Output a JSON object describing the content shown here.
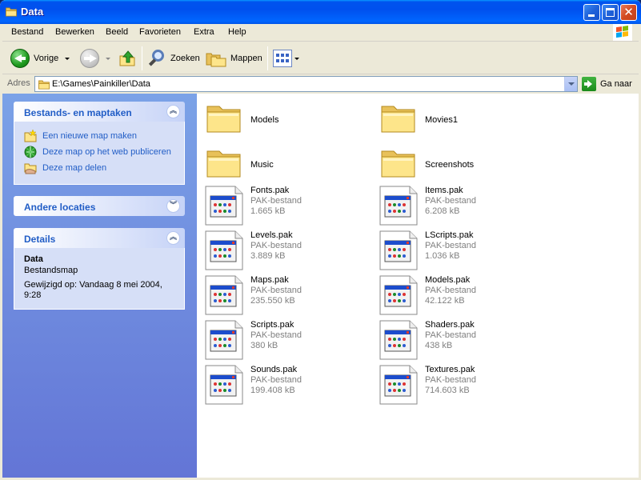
{
  "window": {
    "title": "Data"
  },
  "menu": [
    "Bestand",
    "Bewerken",
    "Beeld",
    "Favorieten",
    "Extra",
    "Help"
  ],
  "toolbar": {
    "back": "Vorige",
    "search": "Zoeken",
    "folders": "Mappen"
  },
  "address": {
    "label": "Adres",
    "value": "E:\\Games\\Painkiller\\Data",
    "go": "Ga naar"
  },
  "taskpane": {
    "tasks": {
      "title": "Bestands- en maptaken",
      "items": [
        "Een nieuwe map maken",
        "Deze map op het web publiceren",
        "Deze map delen"
      ]
    },
    "other": {
      "title": "Andere locaties"
    },
    "details": {
      "title": "Details",
      "name": "Data",
      "type": "Bestandsmap",
      "modified": "Gewijzigd op: Vandaag 8 mei 2004, 9:28"
    }
  },
  "folders": [
    "Models",
    "Movies1",
    "Music",
    "Screenshots"
  ],
  "files": [
    {
      "name": "Fonts.pak",
      "type": "PAK-bestand",
      "size": "1.665 kB"
    },
    {
      "name": "Items.pak",
      "type": "PAK-bestand",
      "size": "6.208 kB"
    },
    {
      "name": "Levels.pak",
      "type": "PAK-bestand",
      "size": "3.889 kB"
    },
    {
      "name": "LScripts.pak",
      "type": "PAK-bestand",
      "size": "1.036 kB"
    },
    {
      "name": "Maps.pak",
      "type": "PAK-bestand",
      "size": "235.550 kB"
    },
    {
      "name": "Models.pak",
      "type": "PAK-bestand",
      "size": "42.122 kB"
    },
    {
      "name": "Scripts.pak",
      "type": "PAK-bestand",
      "size": "380 kB"
    },
    {
      "name": "Shaders.pak",
      "type": "PAK-bestand",
      "size": "438 kB"
    },
    {
      "name": "Sounds.pak",
      "type": "PAK-bestand",
      "size": "199.408 kB"
    },
    {
      "name": "Textures.pak",
      "type": "PAK-bestand",
      "size": "714.603 kB"
    }
  ]
}
